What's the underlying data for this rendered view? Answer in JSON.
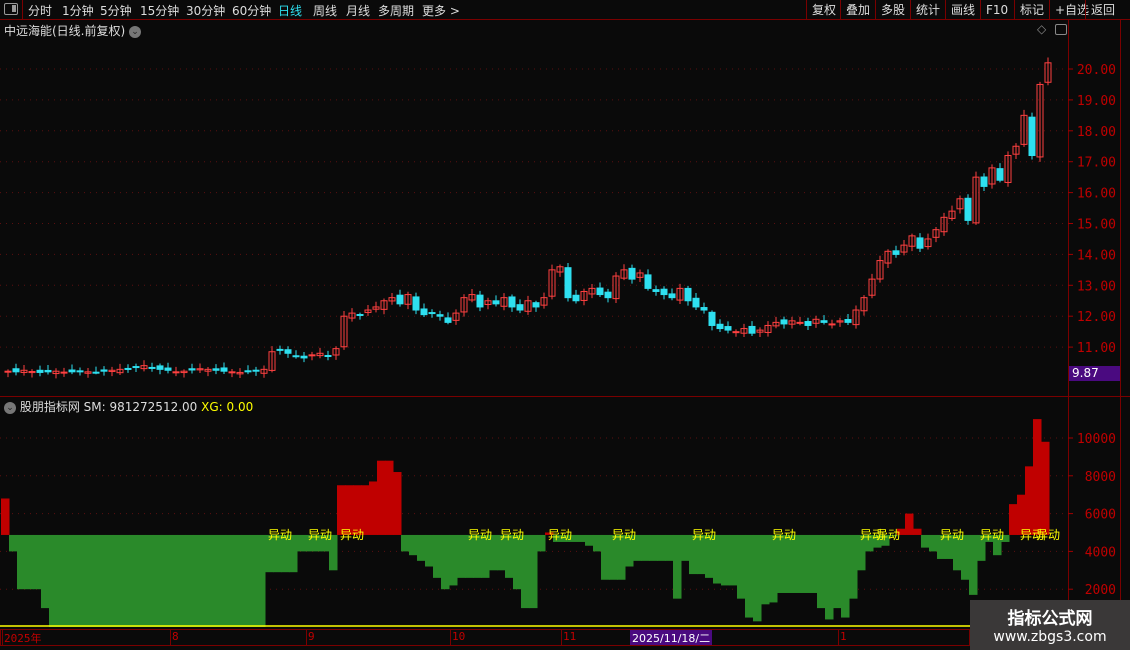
{
  "toolbar": {
    "periods": [
      "分时",
      "1分钟",
      "5分钟",
      "15分钟",
      "30分钟",
      "60分钟",
      "日线",
      "周线",
      "月线",
      "多周期",
      "更多 >"
    ],
    "active_period": "日线",
    "right_buttons": [
      "复权",
      "叠加",
      "多股",
      "统计",
      "画线",
      "F10",
      "标记",
      "+自选",
      "返回"
    ]
  },
  "main_chart": {
    "title": "中远海能(日线.前复权)",
    "price_ticks": [
      "20.00",
      "19.00",
      "18.00",
      "17.00",
      "16.00",
      "15.00",
      "14.00",
      "13.00",
      "12.00",
      "11.00"
    ],
    "current_price": "9.87",
    "closes": [
      10.22,
      10.2,
      10.25,
      10.21,
      10.18,
      10.2,
      10.22,
      10.19,
      10.2,
      10.23,
      10.2,
      10.18,
      10.22,
      10.25,
      10.28,
      10.3,
      10.35,
      10.4,
      10.33,
      10.28,
      10.25,
      10.2,
      10.22,
      10.26,
      10.3,
      10.28,
      10.25,
      10.22,
      10.2,
      10.18,
      10.2,
      10.22,
      10.28,
      10.85,
      10.9,
      10.8,
      10.7,
      10.65,
      10.75,
      10.8,
      10.7,
      10.95,
      12.0,
      12.1,
      12.05,
      12.2,
      12.3,
      12.5,
      12.6,
      12.4,
      12.7,
      12.2,
      12.05,
      12.1,
      12.0,
      11.8,
      12.1,
      12.6,
      12.7,
      12.3,
      12.5,
      12.4,
      12.6,
      12.3,
      12.2,
      12.5,
      12.3,
      12.6,
      13.5,
      13.6,
      12.6,
      12.5,
      12.8,
      12.9,
      12.7,
      12.6,
      13.3,
      13.5,
      13.2,
      13.4,
      12.9,
      12.8,
      12.7,
      12.6,
      12.9,
      12.5,
      12.3,
      12.2,
      11.7,
      11.6,
      11.55,
      11.5,
      11.6,
      11.45,
      11.55,
      11.7,
      11.8,
      11.75,
      11.85,
      11.8,
      11.7,
      11.9,
      11.8,
      11.75,
      11.85,
      11.8,
      12.2,
      12.6,
      13.2,
      13.8,
      14.1,
      14.0,
      14.3,
      14.6,
      14.2,
      14.5,
      14.8,
      15.2,
      15.4,
      15.8,
      15.1,
      16.5,
      16.2,
      16.8,
      16.4,
      17.2,
      17.5,
      18.5,
      17.2,
      19.5,
      20.2
    ],
    "up_color": "#ff4040",
    "down_color": "#2ee0f0"
  },
  "indicator": {
    "name": "股朋指标网",
    "sm_label": "SM: 981272512.00",
    "xg_label": "XG: 0.00",
    "ticks": [
      "10000",
      "8000",
      "6000",
      "4000",
      "2000"
    ],
    "baseline": 4870,
    "values": [
      6800,
      4000,
      2000,
      2000,
      2000,
      1000,
      0,
      0,
      0,
      0,
      0,
      0,
      0,
      0,
      0,
      0,
      0,
      0,
      0,
      0,
      0,
      0,
      0,
      0,
      0,
      0,
      0,
      0,
      0,
      0,
      0,
      0,
      0,
      2900,
      2900,
      2900,
      2900,
      4000,
      4000,
      4000,
      4000,
      3000,
      7500,
      7500,
      7500,
      7500,
      7700,
      8800,
      8800,
      8200,
      4000,
      3800,
      3500,
      3200,
      2600,
      2000,
      2200,
      2600,
      2600,
      2600,
      2600,
      3000,
      3000,
      2600,
      2000,
      1000,
      1000,
      4000,
      5000,
      4500,
      4500,
      4500,
      4500,
      4300,
      4000,
      2500,
      2500,
      2500,
      3200,
      3500,
      3500,
      3500,
      3500,
      3500,
      1500,
      3500,
      2800,
      2800,
      2600,
      2300,
      2200,
      2200,
      1500,
      500,
      300,
      1200,
      1300,
      1800,
      1800,
      1800,
      1800,
      1800,
      1000,
      400,
      1000,
      500,
      1500,
      3000,
      4000,
      4200,
      4300,
      4800,
      5200,
      6000,
      5200,
      4200,
      4000,
      3600,
      3600,
      3000,
      2500,
      1700,
      3500,
      4500,
      3800,
      4500,
      6500,
      7000,
      8500,
      11000,
      9800
    ],
    "signal_label": "异动",
    "signal_bars": [
      34,
      39,
      43,
      59,
      63,
      69,
      77,
      87,
      97,
      108,
      110,
      118,
      123,
      128,
      130
    ],
    "up_color": "#c00000",
    "down_color": "#2a8a2a",
    "signal_color": "#ffff00"
  },
  "time_axis": {
    "labels": [
      "2025年",
      "8",
      "9",
      "10",
      "11",
      "1"
    ],
    "cursor_date": "2025/11/18/二"
  },
  "watermark": {
    "title": "指标公式网",
    "url": "www.zbgs3.com"
  }
}
